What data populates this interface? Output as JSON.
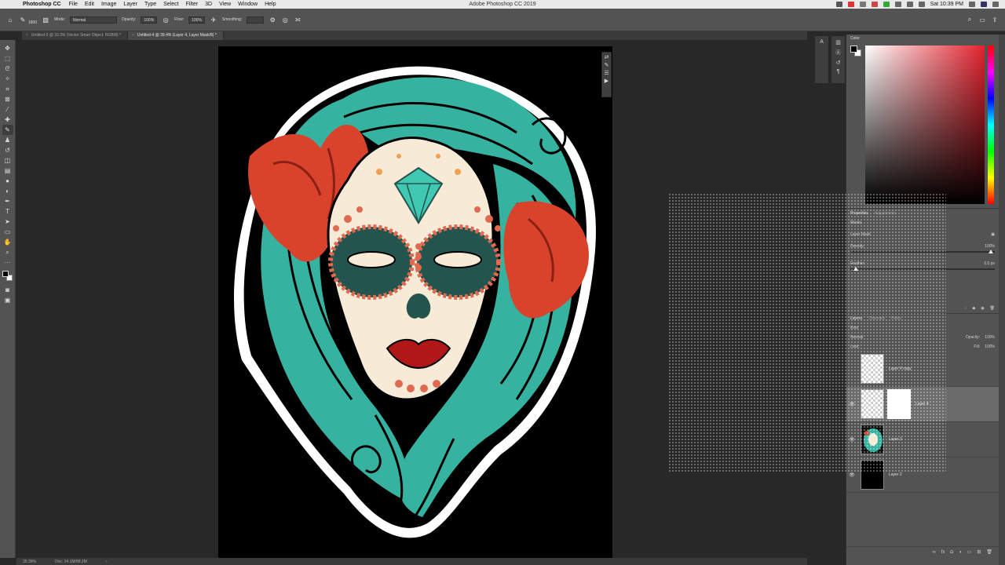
{
  "menubar": {
    "app_name": "Photoshop CC",
    "menus": [
      "File",
      "Edit",
      "Image",
      "Layer",
      "Type",
      "Select",
      "Filter",
      "3D",
      "View",
      "Window",
      "Help"
    ],
    "window_title": "Adobe Photoshop CC 2019",
    "clock": "Sat 10:39 PM"
  },
  "options": {
    "brush_size": "1800",
    "mode_label": "Mode:",
    "mode_value": "Normal",
    "opacity_label": "Opacity:",
    "opacity_value": "100%",
    "flow_label": "Flow:",
    "flow_value": "100%",
    "smoothing_label": "Smoothing:"
  },
  "tabs": [
    {
      "label": "Untitled-3 @ 33.3% (Vector Smart Object, RGB/8) *"
    },
    {
      "label": "Untitled-4 @ 39.4% (Layer 4, Layer Mask/8) *"
    }
  ],
  "status": {
    "zoom": "39.39%",
    "doc": "Doc: 24.1M/88.2M"
  },
  "panels": {
    "color_title": "Color",
    "properties_tab": "Properties",
    "adjustments_tab": "Adjustments",
    "props_masks_label": "Masks",
    "props_layer_mask_label": "Layer Mask",
    "density_label": "Density:",
    "density_value": "100%",
    "feather_label": "Feather:",
    "feather_value": "0.0 px",
    "layers_tabs": [
      "Layers",
      "Channels",
      "Paths"
    ],
    "kind_label": "Kind",
    "blend_mode": "Normal",
    "opacity_label": "Opacity:",
    "opacity_value": "100%",
    "lock_label": "Lock:",
    "fill_label": "Fill:",
    "fill_value": "100%"
  },
  "layers": [
    {
      "name": "Layer 4 copy",
      "selected": false
    },
    {
      "name": "Layer 4",
      "selected": true
    },
    {
      "name": "Layer 3",
      "selected": false
    },
    {
      "name": "Layer 2",
      "selected": false
    }
  ],
  "colors": {
    "teal": "#35b3a0",
    "red": "#d9432c",
    "cream": "#f7ebd8",
    "dark_teal": "#24544e"
  }
}
